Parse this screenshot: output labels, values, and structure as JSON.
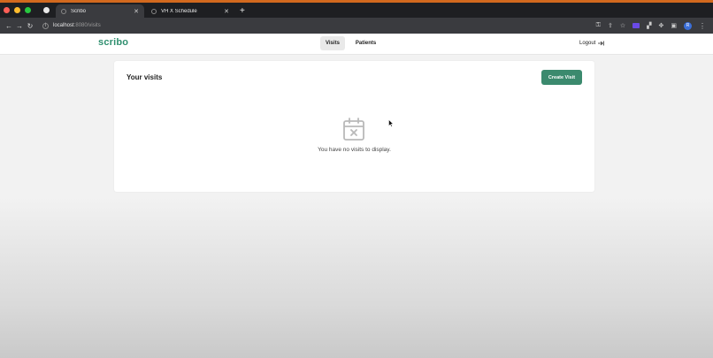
{
  "browser": {
    "tabs": [
      {
        "title": "Scribo",
        "active": true
      },
      {
        "title": "VH X Schedule",
        "active": false
      }
    ],
    "new_tab_symbol": "+",
    "url_host": "localhost",
    "url_path": ":8080/visits",
    "profile_initial": "R"
  },
  "app": {
    "logo": "scribo",
    "nav": [
      {
        "label": "Visits",
        "active": true
      },
      {
        "label": "Patients",
        "active": false
      }
    ],
    "logout_label": "Logout"
  },
  "visits": {
    "title": "Your visits",
    "create_button": "Create Visit",
    "empty_message": "You have no visits to display."
  },
  "colors": {
    "brand": "#2f8f6f",
    "button": "#3b8a6e"
  }
}
